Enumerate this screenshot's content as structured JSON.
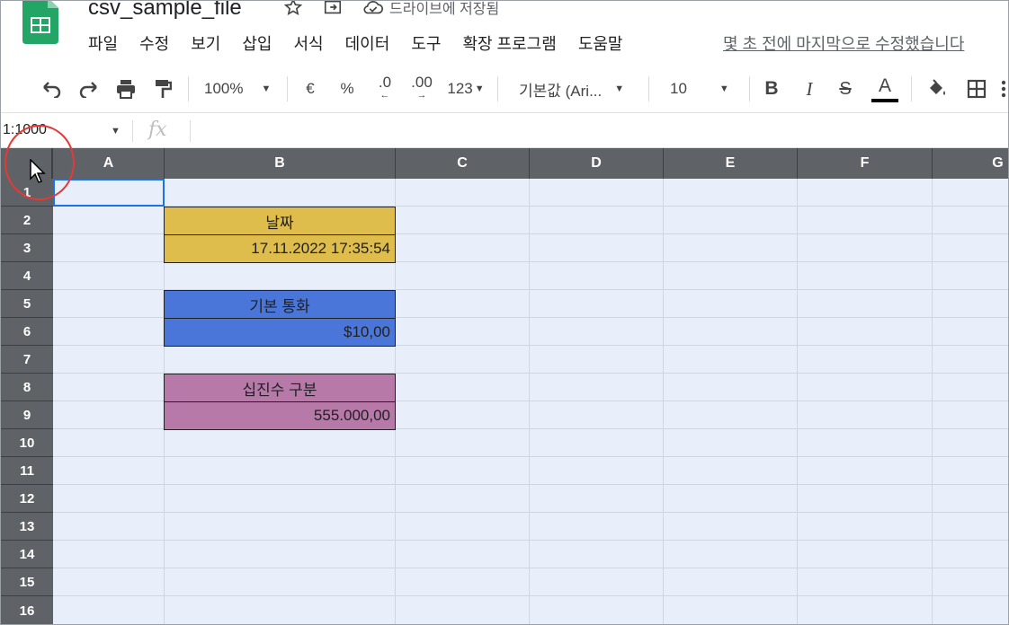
{
  "doc": {
    "title": "csv_sample_file",
    "save_status": "드라이브에 저장됨",
    "last_edit": "몇 초 전에 마지막으로 수정했습니다"
  },
  "menu": [
    "파일",
    "수정",
    "보기",
    "삽입",
    "서식",
    "데이터",
    "도구",
    "확장 프로그램",
    "도움말"
  ],
  "toolbar": {
    "zoom": "100%",
    "currency": "€",
    "percent": "%",
    "dec_less": ".0",
    "dec_more": ".00",
    "format_more": "123",
    "font": "기본값 (Ari...",
    "font_size": "10",
    "bold": "B",
    "italic": "I",
    "strike": "S",
    "text_color": "A"
  },
  "formula_bar": {
    "name_box": "1:1000",
    "fx": "fx"
  },
  "columns": [
    "A",
    "B",
    "C",
    "D",
    "E",
    "F",
    "G"
  ],
  "rows": [
    "1",
    "2",
    "3",
    "4",
    "5",
    "6",
    "7",
    "8",
    "9",
    "10",
    "11",
    "12",
    "13",
    "14",
    "15",
    "16"
  ],
  "cells": {
    "B2": "날짜",
    "B3": "17.11.2022 17:35:54",
    "B5": "기본 통화",
    "B6": "$10,00",
    "B8": "십진수 구분",
    "B9": "555.000,00"
  },
  "colors": {
    "date_fill": "#dfbd4c",
    "currency_fill": "#4a76d9",
    "decimal_fill": "#b779a8",
    "header_fill": "#5f6368",
    "selection": "#1a73e8"
  }
}
